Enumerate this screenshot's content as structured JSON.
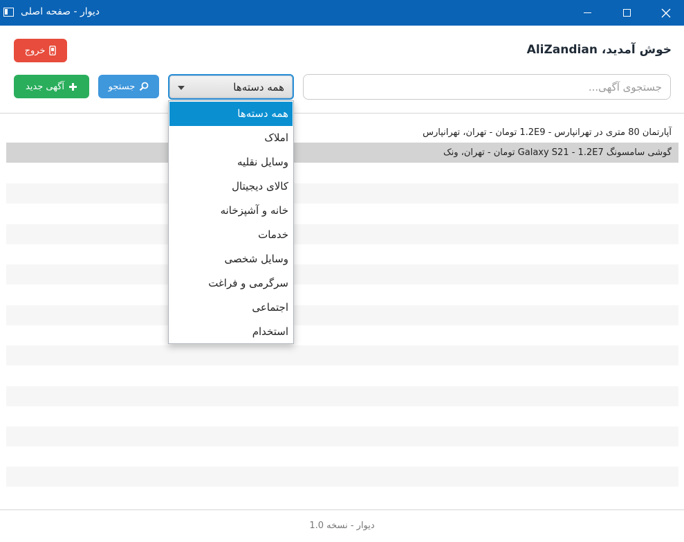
{
  "window": {
    "title": "دیوار - صفحه اصلی"
  },
  "header": {
    "welcome": "خوش آمدید، AliZandian",
    "logout_label": "خروج"
  },
  "toolbar": {
    "new_ad_label": "آگهی جدید",
    "search_label": "جستجو",
    "category_selected": "همه دسته‌ها",
    "search_placeholder": "جستجوی آگهی..."
  },
  "listings": [
    "آپارتمان 80 متری در تهرانپارس - 1.2E9 تومان - تهران، تهرانپارس",
    "گوشی سامسونگ Galaxy S21 - 1.2E7 تومان - تهران، ونک"
  ],
  "dropdown": {
    "options": [
      "همه دسته‌ها",
      "املاک",
      "وسایل نقلیه",
      "کالای دیجیتال",
      "خانه و آشپزخانه",
      "خدمات",
      "وسایل شخصی",
      "سرگرمی و فراغت",
      "اجتماعی",
      "استخدام"
    ],
    "active_index": 0
  },
  "footer": {
    "text": "دیوار - نسخه 1.0"
  },
  "colors": {
    "titlebar": "#0a63b5",
    "logout": "#e74c3c",
    "new_ad": "#2aae5c",
    "search": "#3f97dc",
    "selected_option": "#0a8fd1"
  }
}
